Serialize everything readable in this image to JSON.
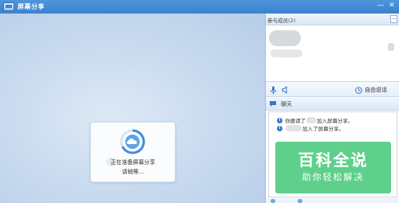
{
  "window": {
    "title": "屏幕分享",
    "minimize_glyph": "—",
    "close_glyph": "✕"
  },
  "share_area": {
    "loading": {
      "line1": "正在准备屏幕分享",
      "line2": "请稍等..."
    }
  },
  "participants": {
    "title": "参与成员(2)",
    "collapse_glyph": "−"
  },
  "audio": {
    "free_talk_label": "自由说话"
  },
  "chat": {
    "title": "聊天",
    "messages": [
      {
        "prefix": "你邀请了",
        "suffix": "加入屏幕分享。"
      },
      {
        "prefix": "",
        "suffix": "加入了屏幕分享。"
      }
    ]
  },
  "watermark": {
    "title": "百科全说",
    "subtitle": "助你轻松解决"
  },
  "colors": {
    "titlebar": "#3b82cf",
    "accent": "#3c78c6",
    "watermark": "#5fd08c"
  },
  "icons": [
    "app-icon",
    "cloud-spinner-icon",
    "microphone-icon",
    "speaker-icon",
    "free-talk-icon",
    "chat-icon",
    "info-icon"
  ]
}
